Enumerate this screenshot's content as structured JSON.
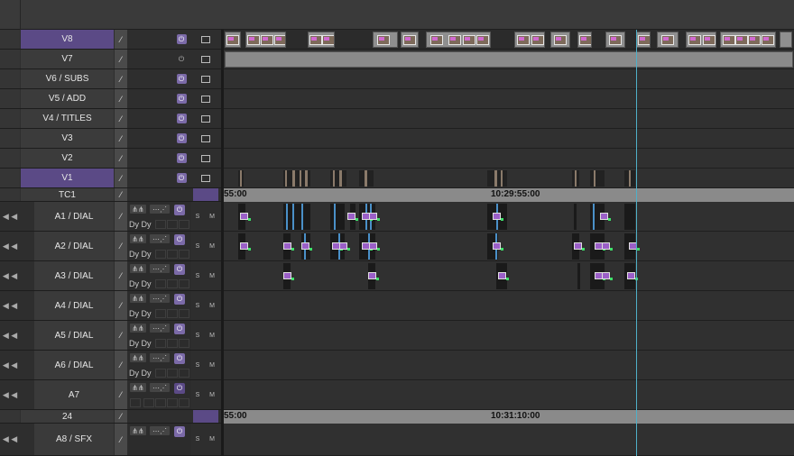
{
  "tracks": {
    "v8": "V8",
    "v7": "V7",
    "v6": "V6 / SUBS",
    "v5": "V5 / ADD",
    "v4": "V4 / TITLES",
    "v3": "V3",
    "v2": "V2",
    "v1": "V1",
    "tc1": "TC1",
    "a1": "A1 / DIAL",
    "a2": "A2 / DIAL",
    "a3": "A3 / DIAL",
    "a4": "A4 / DIAL",
    "a5": "A5 / DIAL",
    "a6": "A6 / DIAL",
    "a7": "A7",
    "tc24": "24",
    "a8": "A8 / SFX"
  },
  "labels": {
    "dy": "Dy Dy",
    "solo": "S",
    "mute": "M"
  },
  "rulers": {
    "tc1_left": "55:00",
    "tc1_center": "10:29:55:00",
    "tc24_left": "55:00",
    "tc24_center": "10:31:10:00"
  },
  "colors": {
    "selected_track": "#5b4a86",
    "playhead": "#4fb0c8",
    "waveform": "#4a90c8"
  }
}
